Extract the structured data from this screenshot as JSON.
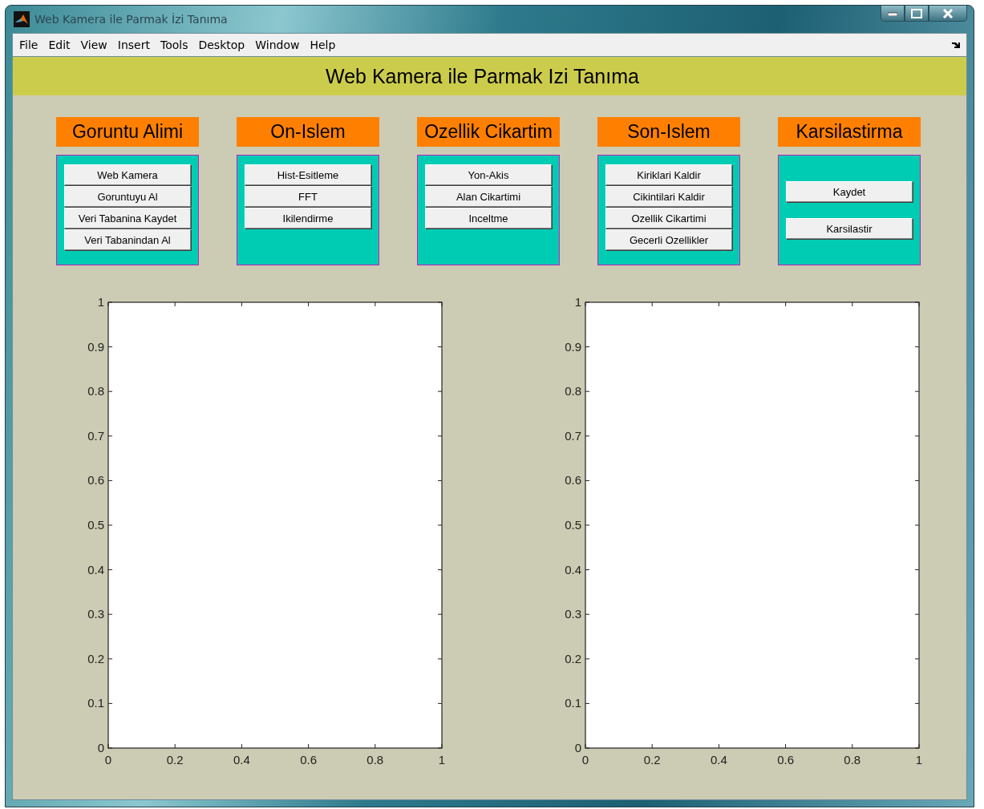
{
  "window": {
    "title": "Web Kamera ile Parmak İzi Tanıma"
  },
  "menu": [
    "File",
    "Edit",
    "View",
    "Insert",
    "Tools",
    "Desktop",
    "Window",
    "Help"
  ],
  "header": "Web Kamera ile Parmak Izi Tanıma",
  "panels": [
    {
      "title": "Goruntu Alimi",
      "kind": "stacked",
      "buttons": [
        "Web Kamera",
        "Goruntuyu Al",
        "Veri Tabanina Kaydet",
        "Veri Tabanindan Al"
      ]
    },
    {
      "title": "On-Islem",
      "kind": "stacked",
      "buttons": [
        "Hist-Esitleme",
        "FFT",
        "Ikilendirme"
      ]
    },
    {
      "title": "Ozellik Cikartim",
      "kind": "stacked",
      "buttons": [
        "Yon-Akis",
        "Alan Cikartimi",
        "Inceltme"
      ]
    },
    {
      "title": "Son-Islem",
      "kind": "stacked",
      "buttons": [
        "Kiriklari Kaldir",
        "Cikintilari Kaldir",
        "Ozellik Cikartimi",
        "Gecerli Ozellikler"
      ]
    },
    {
      "title": "Karsilastirma",
      "kind": "spaced",
      "buttons": [
        "Kaydet",
        "Karsilastir"
      ]
    }
  ],
  "axes": [
    {
      "chart_data": {
        "type": "line",
        "xlim": [
          0,
          1
        ],
        "ylim": [
          0,
          1
        ],
        "xticks": [
          {
            "value": 0,
            "label": "0"
          },
          {
            "value": 0.2,
            "label": "0.2"
          },
          {
            "value": 0.4,
            "label": "0.4"
          },
          {
            "value": 0.6,
            "label": "0.6"
          },
          {
            "value": 0.8,
            "label": "0.8"
          },
          {
            "value": 1,
            "label": "1"
          }
        ],
        "yticks": [
          {
            "value": 0,
            "label": "0"
          },
          {
            "value": 0.1,
            "label": "0.1"
          },
          {
            "value": 0.2,
            "label": "0.2"
          },
          {
            "value": 0.3,
            "label": "0.3"
          },
          {
            "value": 0.4,
            "label": "0.4"
          },
          {
            "value": 0.5,
            "label": "0.5"
          },
          {
            "value": 0.6,
            "label": "0.6"
          },
          {
            "value": 0.7,
            "label": "0.7"
          },
          {
            "value": 0.8,
            "label": "0.8"
          },
          {
            "value": 0.9,
            "label": "0.9"
          },
          {
            "value": 1,
            "label": "1"
          }
        ]
      }
    },
    {
      "chart_data": {
        "type": "line",
        "xlim": [
          0,
          1
        ],
        "ylim": [
          0,
          1
        ],
        "xticks": [
          {
            "value": 0,
            "label": "0"
          },
          {
            "value": 0.2,
            "label": "0.2"
          },
          {
            "value": 0.4,
            "label": "0.4"
          },
          {
            "value": 0.6,
            "label": "0.6"
          },
          {
            "value": 0.8,
            "label": "0.8"
          },
          {
            "value": 1,
            "label": "1"
          }
        ],
        "yticks": [
          {
            "value": 0,
            "label": "0"
          },
          {
            "value": 0.1,
            "label": "0.1"
          },
          {
            "value": 0.2,
            "label": "0.2"
          },
          {
            "value": 0.3,
            "label": "0.3"
          },
          {
            "value": 0.4,
            "label": "0.4"
          },
          {
            "value": 0.5,
            "label": "0.5"
          },
          {
            "value": 0.6,
            "label": "0.6"
          },
          {
            "value": 0.7,
            "label": "0.7"
          },
          {
            "value": 0.8,
            "label": "0.8"
          },
          {
            "value": 0.9,
            "label": "0.9"
          },
          {
            "value": 1,
            "label": "1"
          }
        ]
      }
    }
  ]
}
